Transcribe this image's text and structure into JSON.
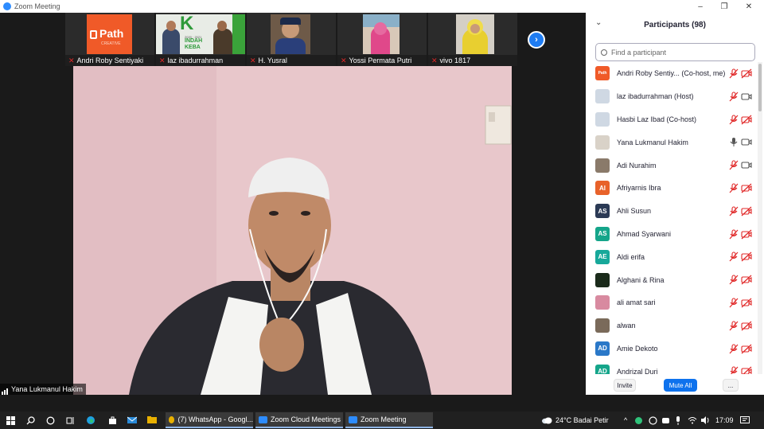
{
  "window": {
    "title": "Zoom Meeting",
    "minimize": "–",
    "maximize": "❐",
    "close": "✕"
  },
  "thumbnails": [
    {
      "name": "Andri Roby Sentiyaki",
      "logo_text": "Path",
      "logo_sub": "CREATIVE"
    },
    {
      "name": "laz ibadurrahman",
      "logo_letter": "K",
      "banner_line1": "2020 · 2021",
      "banner_line2": "INDAH",
      "banner_line3": "KEBA"
    },
    {
      "name": "H. Yusral"
    },
    {
      "name": "Yossi Permata Putri"
    },
    {
      "name": "vivo 1817"
    }
  ],
  "next_page": "›",
  "speaker": {
    "name": "Yana Lukmanul Hakim"
  },
  "panel": {
    "collapse": "⌄",
    "title": "Participants (98)",
    "search_placeholder": "Find a participant",
    "participants": [
      {
        "name": "Andri Roby Sentiy... (Co-host, me)",
        "initials": "Path",
        "color": "#f05a28",
        "mic": "muted",
        "cam": "off"
      },
      {
        "name": "laz ibadurrahman (Host)",
        "initials": "",
        "color": "#cfd8e3",
        "mic": "muted",
        "cam": "on"
      },
      {
        "name": "Hasbi Laz Ibad (Co-host)",
        "initials": "",
        "color": "#cfd8e3",
        "mic": "muted",
        "cam": "off"
      },
      {
        "name": "Yana Lukmanul Hakim",
        "initials": "",
        "color": "#d9d2c8",
        "mic": "on",
        "cam": "on"
      },
      {
        "name": "Adi Nurahim",
        "initials": "",
        "color": "#8a7a6a",
        "mic": "muted",
        "cam": "on"
      },
      {
        "name": "Afriyarnis Ibra",
        "initials": "AI",
        "color": "#e8622a",
        "mic": "muted",
        "cam": "off"
      },
      {
        "name": "Ahli Susun",
        "initials": "AS",
        "color": "#2b3a55",
        "mic": "muted",
        "cam": "off"
      },
      {
        "name": "Ahmad Syarwani",
        "initials": "AS",
        "color": "#15a58a",
        "mic": "muted",
        "cam": "off"
      },
      {
        "name": "Aldi erifa",
        "initials": "AE",
        "color": "#17a89a",
        "mic": "muted",
        "cam": "off"
      },
      {
        "name": "Alghani & Rina",
        "initials": "",
        "color": "#1b2b1b",
        "mic": "muted",
        "cam": "off"
      },
      {
        "name": "ali amat sari",
        "initials": "",
        "color": "#d88aa0",
        "mic": "muted",
        "cam": "off"
      },
      {
        "name": "alwan",
        "initials": "",
        "color": "#7a6a5a",
        "mic": "muted",
        "cam": "off"
      },
      {
        "name": "Amie Dekoto",
        "initials": "AD",
        "color": "#2a78c8",
        "mic": "muted",
        "cam": "off"
      },
      {
        "name": "Andrizal Duri",
        "initials": "AD",
        "color": "#15a58a",
        "mic": "muted",
        "cam": "off"
      }
    ],
    "invite": "Invite",
    "mute_all": "Mute All",
    "more": "..."
  },
  "taskbar": {
    "apps": [
      {
        "label": "(7) WhatsApp - Googl...",
        "color": "#e8b000"
      },
      {
        "label": "Zoom Cloud Meetings",
        "color": "#2d8cff"
      },
      {
        "label": "Zoom Meeting",
        "color": "#2d8cff"
      }
    ],
    "weather": "24°C  Badai Petir",
    "time": "17:09",
    "tray_arrow": "^"
  }
}
